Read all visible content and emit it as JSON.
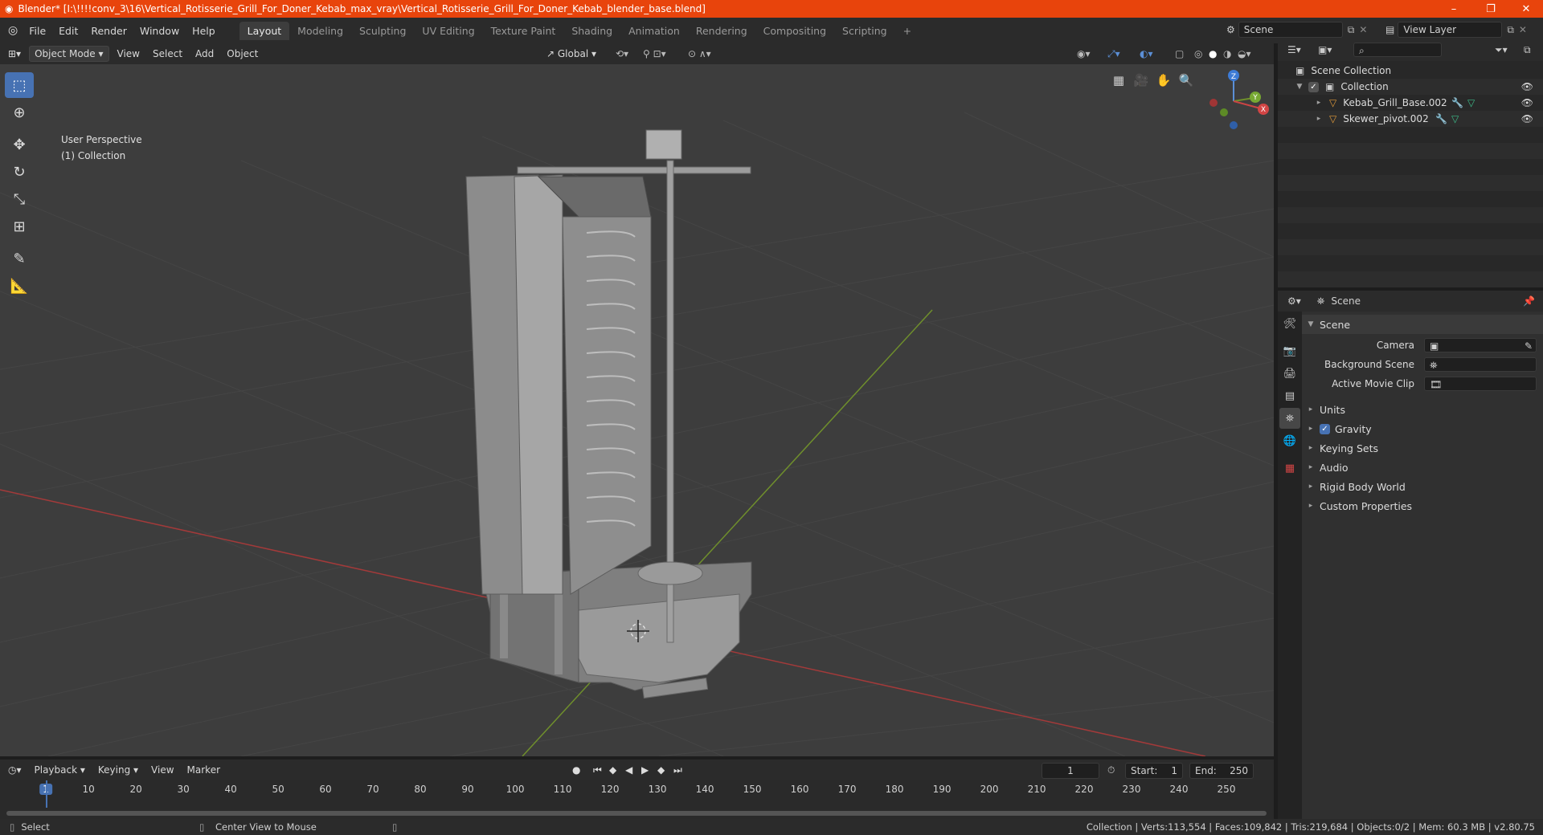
{
  "window": {
    "title": "Blender* [I:\\!!!!conv_3\\16\\Vertical_Rotisserie_Grill_For_Doner_Kebab_max_vray\\Vertical_Rotisserie_Grill_For_Doner_Kebab_blender_base.blend]",
    "minimize": "–",
    "maximize": "❐",
    "close": "✕"
  },
  "menu": {
    "items": [
      "File",
      "Edit",
      "Render",
      "Window",
      "Help"
    ],
    "workspaces": [
      "Layout",
      "Modeling",
      "Sculpting",
      "UV Editing",
      "Texture Paint",
      "Shading",
      "Animation",
      "Rendering",
      "Compositing",
      "Scripting"
    ],
    "active_workspace": "Layout",
    "add_workspace": "+",
    "scene_name": "Scene",
    "view_layer": "View Layer"
  },
  "viewport_header": {
    "mode": "Object Mode",
    "menus": [
      "View",
      "Select",
      "Add",
      "Object"
    ],
    "orientation": "Global"
  },
  "viewport": {
    "perspective": "User Perspective",
    "collection": "(1) Collection",
    "gizmo": {
      "z": "Z",
      "y": "Y",
      "x": "X"
    }
  },
  "outliner": {
    "root": "Scene Collection",
    "collection": "Collection",
    "objects": [
      "Kebab_Grill_Base.002",
      "Skewer_pivot.002"
    ]
  },
  "properties": {
    "header": "Scene",
    "panel": "Scene",
    "fields": [
      {
        "label": "Camera",
        "value": ""
      },
      {
        "label": "Background Scene",
        "value": ""
      },
      {
        "label": "Active Movie Clip",
        "value": ""
      }
    ],
    "sections": [
      "Units",
      "Gravity",
      "Keying Sets",
      "Audio",
      "Rigid Body World",
      "Custom Properties"
    ],
    "gravity_checked": true
  },
  "timeline": {
    "menus": [
      "Playback",
      "Keying",
      "View",
      "Marker"
    ],
    "current_frame": "1",
    "start_label": "Start:",
    "start": "1",
    "end_label": "End:",
    "end": "250",
    "ticks": [
      "1",
      "10",
      "20",
      "30",
      "40",
      "50",
      "60",
      "70",
      "80",
      "90",
      "100",
      "110",
      "120",
      "130",
      "140",
      "150",
      "160",
      "170",
      "180",
      "190",
      "200",
      "210",
      "220",
      "230",
      "240",
      "250"
    ]
  },
  "statusbar": {
    "left_action": "Select",
    "mid_action": "Center View to Mouse",
    "stats": "Collection | Verts:113,554 | Faces:109,842 | Tris:219,684 | Objects:0/2 | Mem: 60.3 MB | v2.80.75"
  },
  "colors": {
    "title_bar": "#e8440c",
    "accent": "#4772b3",
    "viewport_bg": "#3d3d3d",
    "x_axis": "#a33a3a",
    "y_axis": "#6f8f2c",
    "object_icon": "#e09a3a"
  },
  "icons": [
    "blender-logo-icon",
    "select-box-icon",
    "cursor-icon",
    "move-icon",
    "rotate-icon",
    "scale-icon",
    "transform-icon",
    "annotate-icon",
    "measure-icon",
    "eye-icon",
    "camera-icon",
    "hand-icon",
    "zoom-icon",
    "grid-icon"
  ]
}
